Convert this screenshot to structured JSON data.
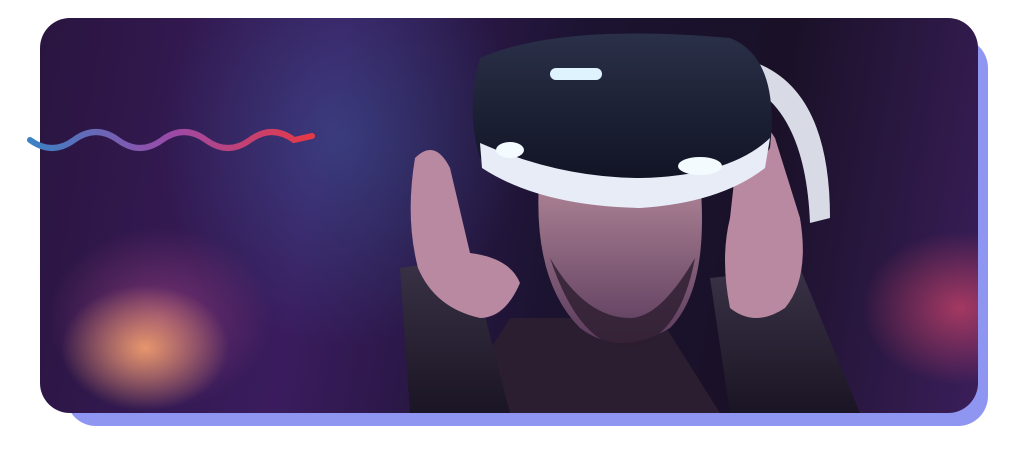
{
  "scene": {
    "subject_icon": "vr-headset-person-icon",
    "colors": {
      "shadow": "#8f96f2",
      "wave_start": "#3b82c4",
      "wave_mid": "#9b4aa8",
      "wave_end": "#e63946"
    }
  }
}
